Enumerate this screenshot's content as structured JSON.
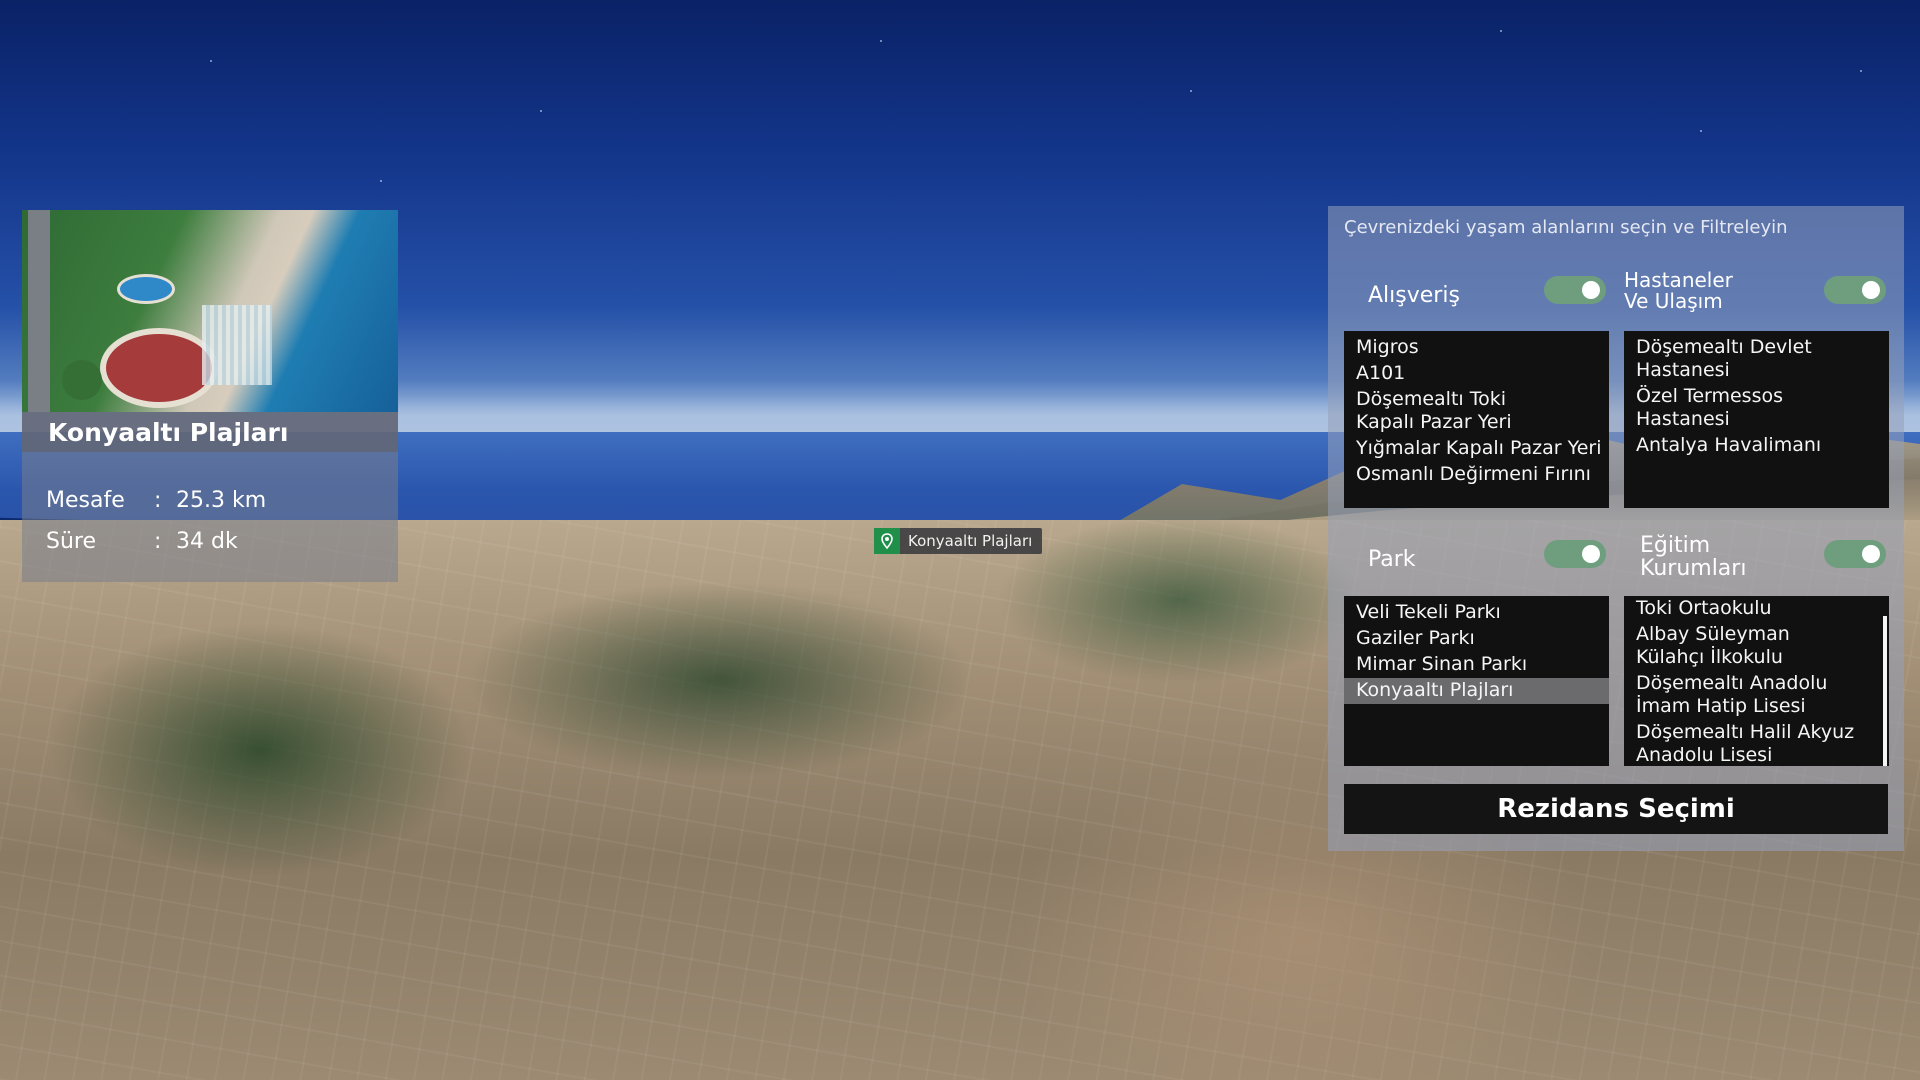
{
  "marker": {
    "label": "Konyaaltı Plajları",
    "icon": "map-pin-icon"
  },
  "info_card": {
    "title": "Konyaaltı Plajları",
    "rows": [
      {
        "key": "Mesafe",
        "sep": ":",
        "value": "25.3 km"
      },
      {
        "key": "Süre",
        "sep": ":",
        "value": "34 dk"
      }
    ]
  },
  "panel": {
    "title": "Çevrenizdeki yaşam alanlarını seçin ve Filtreleyin",
    "toggle_color": "#6f9e7e",
    "categories": {
      "shopping": {
        "label": "Alışveriş",
        "enabled": true,
        "items": [
          "Migros",
          "A101",
          "Döşemealtı Toki Kapalı Pazar Yeri",
          "Yığmalar Kapalı Pazar Yeri",
          "Osmanlı Değirmeni Fırını"
        ]
      },
      "hospitals": {
        "label_line1": "Hastaneler",
        "label_line2": "Ve Ulaşım",
        "enabled": true,
        "items": [
          "Döşemealtı Devlet Hastanesi",
          "Özel Termessos Hastanesi",
          "Antalya Havalimanı"
        ]
      },
      "park": {
        "label": "Park",
        "enabled": true,
        "items": [
          "Veli Tekeli Parkı",
          "Gaziler Parkı",
          "Mimar Sinan Parkı",
          "Konyaaltı Plajları"
        ],
        "selected": "Konyaaltı Plajları"
      },
      "education": {
        "label_line1": "Eğitim",
        "label_line2": "Kurumları",
        "enabled": true,
        "items": [
          "Toki Ortaokulu",
          "Albay Süleyman Külahçı İlkokulu",
          "Döşemealtı Anadolu İmam Hatip Lisesi",
          "Döşemealtı Halil Akyuz Anadolu Lisesi"
        ]
      }
    },
    "cta_label": "Rezidans Seçimi"
  }
}
